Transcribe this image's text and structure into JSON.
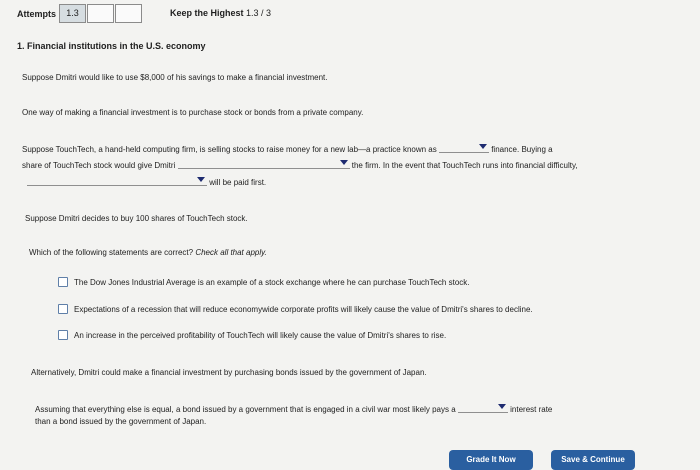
{
  "header": {
    "attempts_label": "Attempts",
    "attempts": [
      "1.3",
      "",
      ""
    ],
    "keep_label": "Keep the Highest",
    "keep_score": "1.3 / 3"
  },
  "question": {
    "title": "1. Financial institutions in the U.S. economy",
    "intro": "Suppose Dmitri would like to use $8,000 of his savings to make a financial investment.",
    "way": "One way of making a financial investment is to purchase stock or bonds from a private company.",
    "stock_line1_a": "Suppose TouchTech, a hand-held computing firm, is selling stocks to raise money for a new lab—a practice known as",
    "stock_line1_b": "finance. Buying a",
    "stock_line2_a": "share of TouchTech stock would give Dmitri",
    "stock_line2_b": "the firm. In the event that TouchTech runs into financial difficulty,",
    "stock_line3": "will be paid first.",
    "buy": "Suppose Dmitri decides to buy 100 shares of TouchTech stock.",
    "which_a": "Which of the following statements are correct?",
    "which_b": "Check all that apply.",
    "options": [
      "The Dow Jones Industrial Average is an example of a stock exchange where he can purchase TouchTech stock.",
      "Expectations of a recession that will reduce economywide corporate profits will likely cause the value of Dmitri's shares to decline.",
      "An increase in the perceived profitability of TouchTech will likely cause the value of Dmitri's shares to rise."
    ],
    "alt": "Alternatively, Dmitri could make a financial investment by purchasing bonds issued by the government of Japan.",
    "bond_line1_a": "Assuming that everything else is equal, a bond issued by a government that is engaged in a civil war most likely pays a",
    "bond_line1_b": "interest rate",
    "bond_line2": "than a bond issued by the government of Japan."
  },
  "buttons": {
    "grade": "Grade It Now",
    "save": "Save & Continue"
  }
}
